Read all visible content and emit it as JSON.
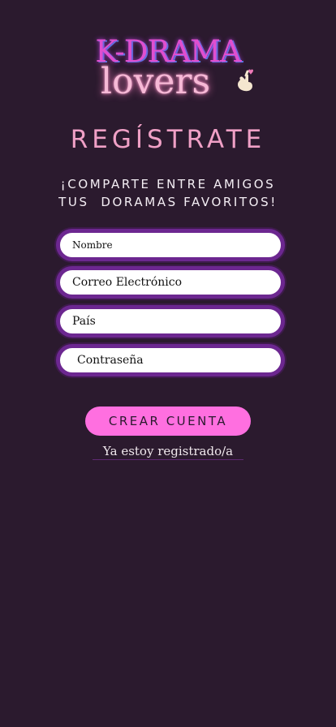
{
  "logo": {
    "line1": "K-DRAMA",
    "line2": "lovers",
    "icon": "finger-heart-icon"
  },
  "header": {
    "title": "REGÍSTRATE",
    "subtitle_line1": "¡COMPARTE ENTRE AMIGOS",
    "subtitle_line2": "TUS  DORAMAS FAVORITOS!"
  },
  "form": {
    "name_placeholder": "Nombre",
    "email_placeholder": "Correo Electrónico",
    "country_placeholder": "País",
    "password_placeholder": "Contraseña",
    "submit_label": "CREAR CUENTA",
    "login_link": "Ya estoy registrado/a"
  },
  "colors": {
    "background": "#2b1a2e",
    "accent_pink": "#ff6fe0",
    "title_pink": "#f0a0c6",
    "field_border": "#6c2790"
  }
}
